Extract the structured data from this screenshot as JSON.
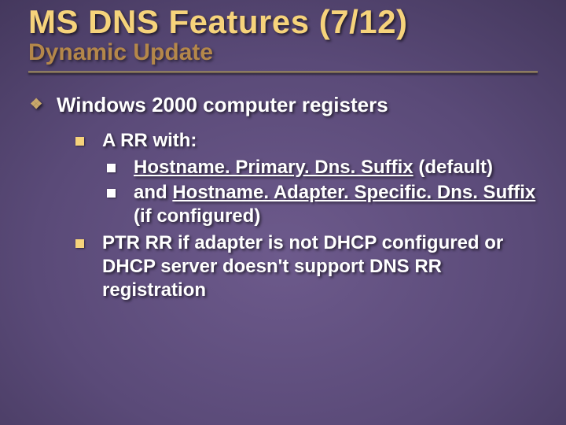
{
  "title": "MS DNS Features (7/12)",
  "subtitle": "Dynamic Update",
  "body": {
    "lvl1_text": "Windows 2000 computer registers",
    "lvl2_a_text": "A RR with:",
    "lvl3_a_pre": "Hostname. Primary. Dns. Suffix",
    "lvl3_a_post": " (default)",
    "lvl3_b_pre": "and ",
    "lvl3_b_u": "Hostname. Adapter. Specific. Dns. Suffix",
    "lvl3_b_post": " (if configured)",
    "lvl2_b_text": "PTR RR if adapter is not DHCP configured or DHCP server doesn't support DNS RR registration"
  }
}
